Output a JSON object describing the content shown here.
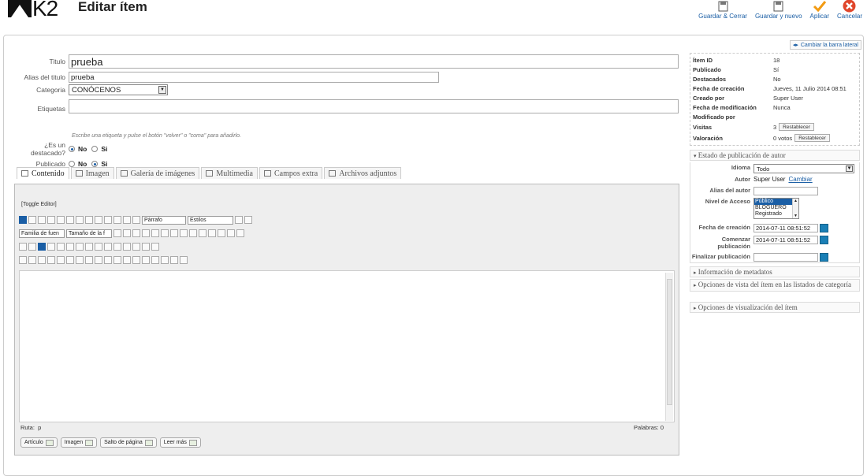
{
  "header": {
    "logo_text": "K2",
    "title": "Editar ítem",
    "buttons": [
      {
        "label": "Guardar & Cerrar",
        "icon": "save-icon"
      },
      {
        "label": "Guardar y nuevo",
        "icon": "save-new-icon"
      },
      {
        "label": "Aplicar",
        "icon": "check-icon"
      },
      {
        "label": "Cancelar",
        "icon": "cancel-icon"
      }
    ]
  },
  "form": {
    "title_label": "Titulo",
    "title_value": "prueba",
    "alias_label": "Alias del titulo",
    "alias_value": "prueba",
    "category_label": "Categoria",
    "category_value": "CONÓCENOS",
    "tags_label": "Etiquetas",
    "tags_hint": "Escribe una etiqueta y pulse el botón \"volver\" o \"coma\" para añadirlo.",
    "featured_label": "¿Es un destacado?",
    "published_label": "Publicado",
    "no_label": "No",
    "yes_label": "Si"
  },
  "tabs": [
    {
      "label": "Contenido",
      "icon": "pencil-icon"
    },
    {
      "label": "Imagen",
      "icon": "image-icon"
    },
    {
      "label": "Galería de imágenes",
      "icon": "gallery-icon"
    },
    {
      "label": "Multimedia",
      "icon": "film-icon"
    },
    {
      "label": "Campos extra",
      "icon": "fields-icon"
    },
    {
      "label": "Archivos adjuntos",
      "icon": "paperclip-icon"
    }
  ],
  "editor": {
    "toggle_label": "[Toggle Editor]",
    "format_select": "Párrafo",
    "styles_select": "Estilos",
    "font_family_select": "Familia de fuen",
    "font_size_select": "Tamaño de la f",
    "path_label": "Ruta:",
    "path_value": "p",
    "words_label": "Palabras: 0",
    "extra_buttons": [
      "Artículo",
      "Imagen",
      "Salto de página",
      "Leer más"
    ]
  },
  "sidebar": {
    "toggle_label": "Cambiar la barra lateral",
    "info": [
      {
        "key": "Ítem ID",
        "value": "18"
      },
      {
        "key": "Publicado",
        "value": "Sí"
      },
      {
        "key": "Destacados",
        "value": "No"
      },
      {
        "key": "Fecha de creación",
        "value": "Jueves, 11 Julio 2014 08:51"
      },
      {
        "key": "Creado por",
        "value": "Super User"
      },
      {
        "key": "Fecha de modificación",
        "value": "Nunca"
      },
      {
        "key": "Modificado por",
        "value": ""
      },
      {
        "key": "Visitas",
        "value": "3"
      },
      {
        "key": "Valoración",
        "value": "0 votos"
      }
    ],
    "reset_label": "Restablecer",
    "publish_section": "Estado de publicación de autor",
    "language_label": "Idioma",
    "language_value": "Todo",
    "author_label": "Autor",
    "author_value": "Super User",
    "author_change": "Cambiar",
    "author_alias_label": "Alias del autor",
    "access_label": "Nivel de Acceso",
    "access_options": [
      "Público",
      "BLOGUERO",
      "Registrado"
    ],
    "created_label": "Fecha de creación",
    "created_value": "2014-07-11 08:51:52",
    "publish_up_label": "Comenzar publicación",
    "publish_up_value": "2014-07-11 08:51:52",
    "publish_down_label": "Finalizar publicación",
    "metadata_section": "Información de metadatos",
    "category_view_section": "Opciones de vista del ítem en las listados de categoría",
    "item_view_section": "Opciones de visualización del ítem"
  }
}
